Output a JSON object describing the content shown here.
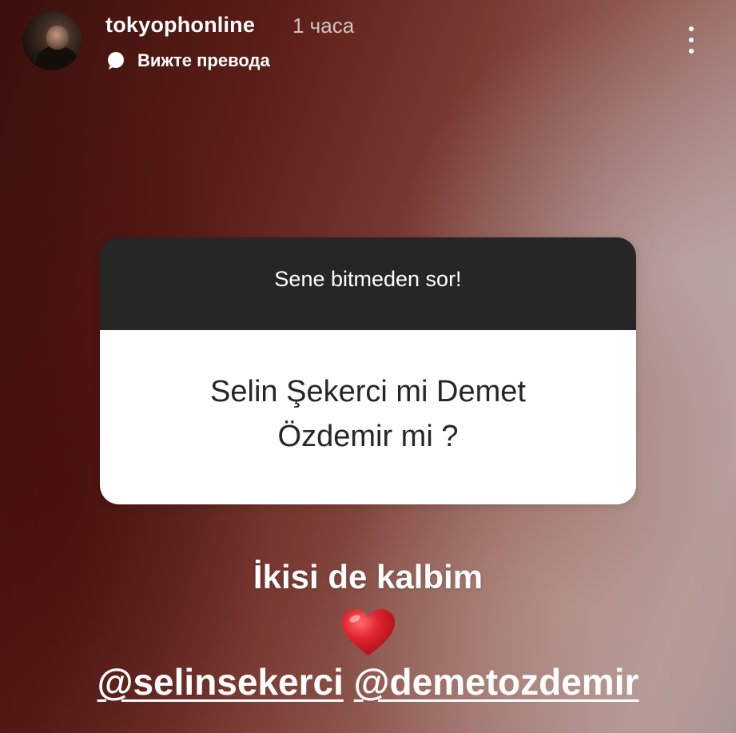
{
  "header": {
    "username": "tokyophonline",
    "timestamp": "1 часа",
    "translate_label": "Вижте превода",
    "icons": {
      "avatar": "profile-avatar",
      "translate": "speech-bubble-icon",
      "more": "more-vertical-icon"
    }
  },
  "question_sticker": {
    "prompt": "Sene bitmeden sor!",
    "question": "Selin Şekerci mi Demet Özdemir mi ?",
    "colors": {
      "header_bg": "#262626",
      "body_bg": "#ffffff",
      "text_dark": "#262626"
    }
  },
  "story": {
    "reply": "İkisi de kalbim",
    "emoji": "❤️",
    "emoji_name": "red-heart-icon",
    "mentions": [
      "@selinsekerci",
      "@demetozdemir"
    ]
  },
  "colors": {
    "background_dark": "#3a0f0c",
    "background_light": "#b49a98",
    "text": "#ffffff",
    "heart": "#e0242f"
  }
}
